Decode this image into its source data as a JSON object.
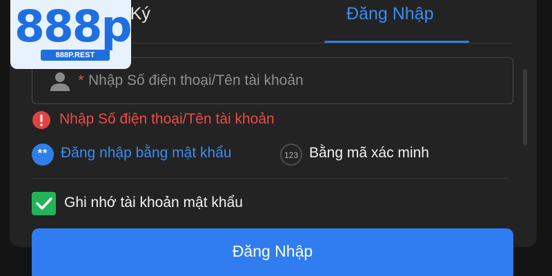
{
  "tabs": {
    "register_label": "ăng Ký",
    "login_label": "Đăng Nhập",
    "active_color": "#2f7fe8"
  },
  "brand": {
    "logo_text": "888p",
    "domain": "888P.REST",
    "color": "#1f6fe0"
  },
  "login_form": {
    "required_mark": "*",
    "account_placeholder": "Nhập Số điện thoại/Tên tài khoản",
    "error_message": "Nhập Số điện thoại/Tên tài khoản",
    "error_color": "#ee4b46",
    "methods": [
      {
        "icon_text": "**",
        "label": "Đăng nhập bằng mật khẩu",
        "selected": true
      },
      {
        "icon_text": "123",
        "label": "Bằng mã xác minh",
        "selected": false
      }
    ],
    "remember": {
      "label": "Ghi nhớ tài khoản mật khẩu",
      "checked": true,
      "color": "#22b456"
    },
    "submit_label": "Đăng Nhập",
    "submit_color": "#2f7df0"
  },
  "icons": [
    "user-icon",
    "error-icon",
    "password-method-icon",
    "otp-method-icon",
    "checkmark-icon"
  ]
}
